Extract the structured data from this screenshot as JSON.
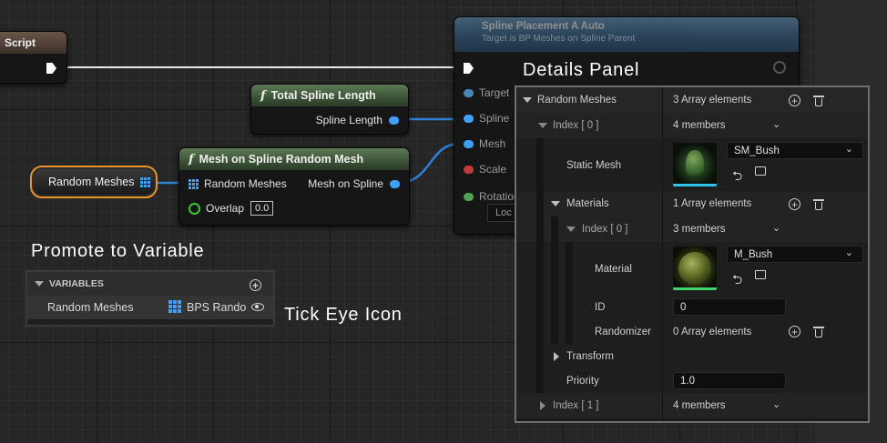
{
  "script_node": {
    "title": "Script"
  },
  "spline_node": {
    "title": "Spline Placement A Auto",
    "subtitle": "Target is BP Meshes on Spline Parent",
    "pins": [
      "Target",
      "Spline",
      "Mesh",
      "Scale",
      "Rotation",
      "Loc"
    ]
  },
  "total_length_node": {
    "title": "Total Spline Length",
    "out_pin": "Spline Length"
  },
  "mesh_node": {
    "title": "Mesh on Spline Random Mesh",
    "in_pin": "Random Meshes",
    "out_pin": "Mesh on Spline",
    "overlap_label": "Overlap",
    "overlap_value": "0.0"
  },
  "variable_node": {
    "label": "Random Meshes"
  },
  "annotations": {
    "promote": "Promote to Variable",
    "tick_eye": "Tick Eye Icon",
    "details": "Details Panel"
  },
  "variables_panel": {
    "header": "VARIABLES",
    "row_name": "Random Meshes",
    "row_type": "BPS Rando"
  },
  "details": {
    "rows": {
      "random_meshes": {
        "label": "Random Meshes",
        "value": "3 Array elements"
      },
      "index0": {
        "label": "Index [ 0 ]",
        "value": "4 members"
      },
      "static_mesh": {
        "label": "Static Mesh",
        "asset": "SM_Bush"
      },
      "materials": {
        "label": "Materials",
        "value": "1 Array elements"
      },
      "mat_index0": {
        "label": "Index [ 0 ]",
        "value": "3 members"
      },
      "material": {
        "label": "Material",
        "asset": "M_Bush"
      },
      "id": {
        "label": "ID",
        "value": "0"
      },
      "randomizer": {
        "label": "Randomizer",
        "value": "0 Array elements"
      },
      "transform": {
        "label": "Transform"
      },
      "priority": {
        "label": "Priority",
        "value": "1.0"
      },
      "index1": {
        "label": "Index [ 1 ]",
        "value": "4 members"
      }
    }
  },
  "colors": {
    "pin_blue": "#3ea0ff",
    "function_header": "#3e5538",
    "spline_header": "#3d6c95",
    "highlight_orange": "#e8942a",
    "overlap_green": "#3ec72f"
  }
}
